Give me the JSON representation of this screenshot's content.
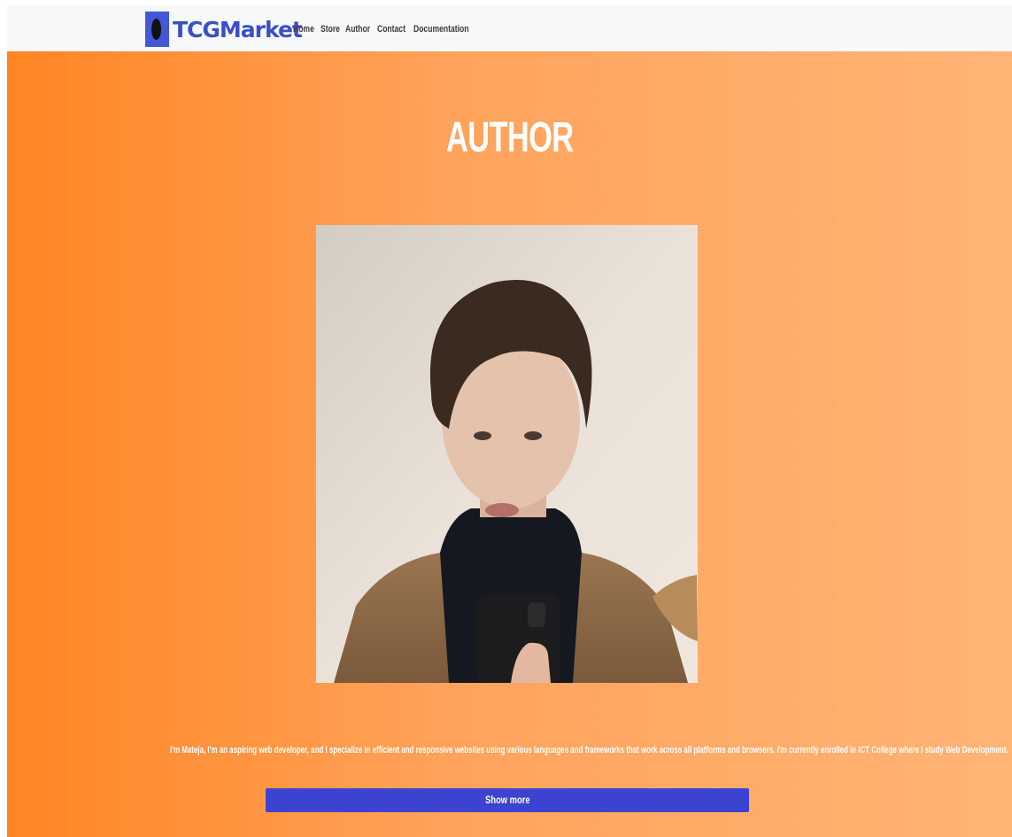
{
  "navbar": {
    "brand": "TCGMarket",
    "logo_icon": "card-logo-icon",
    "links": [
      "Home",
      "Store",
      "Author",
      "Contact",
      "Documentation"
    ]
  },
  "hero": {
    "title": "AUTHOR",
    "photo_alt": "author-photo",
    "bio": "I'm Mateja, I'm an aspiring web developer, and I specialize in efficient and responsive websites using various languages and frameworks that work across all platforms and browsers. I'm currently enrolled in ICT College where I study Web Development.",
    "button_label": "Show more"
  },
  "colors": {
    "gradient_start": "#ff8523",
    "gradient_end": "#ffb476",
    "button": "#3d43d1",
    "brand": "#3b4fc9",
    "logo_box": "#4457d6"
  }
}
